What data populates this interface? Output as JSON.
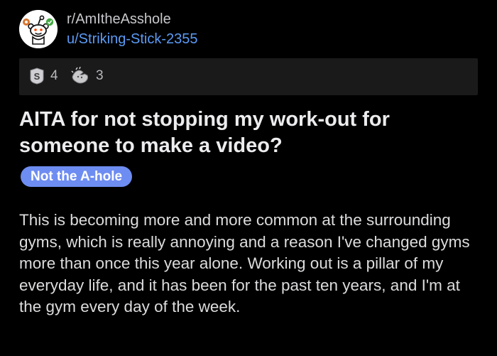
{
  "post": {
    "subreddit": "r/AmItheAsshole",
    "username": "u/Striking-Stick-2355",
    "avatar_icon": "reddit-snoo-avatar-icon",
    "awards": [
      {
        "icon": "silver-award-icon",
        "count": "4"
      },
      {
        "icon": "wholesome-hug-award-icon",
        "count": "3"
      }
    ],
    "title": "AITA for not stopping my work-out for someone to make a video?",
    "flair": "Not the A-hole",
    "body": "This is becoming more and more common at the surrounding gyms, which is really annoying and a reason I've changed gyms more than once this year alone. Working out is a pillar of my everyday life, and it has been for the past ten years, and I'm at the gym every day of the week."
  },
  "colors": {
    "background": "#000000",
    "username": "#5b9bf5",
    "flair_background": "#6e8df2",
    "awards_bar": "#1a1a1b"
  }
}
